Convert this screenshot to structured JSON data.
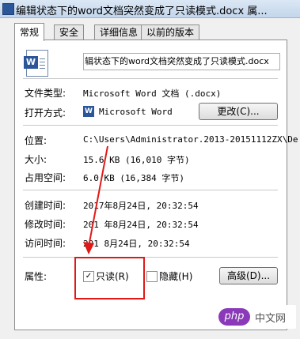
{
  "window": {
    "title": "编辑状态下的word文档突然变成了只读模式.docx 属..."
  },
  "tabs": [
    "常规",
    "安全",
    "详细信息",
    "以前的版本"
  ],
  "file": {
    "name": "辑状态下的word文档突然变成了只读模式.docx"
  },
  "fields": {
    "type_label": "文件类型:",
    "type_value": "Microsoft Word 文档 (.docx)",
    "open_label": "打开方式:",
    "open_value": "Microsoft Word",
    "change_button": "更改(C)...",
    "location_label": "位置:",
    "location_value": "C:\\Users\\Administrator.2013-20151112ZX\\De",
    "size_label": "大小:",
    "size_value": "15.6 KB (16,010 字节)",
    "disk_label": "占用空间:",
    "disk_value": "6.0 KB (16,384 字节)",
    "created_label": "创建时间:",
    "created_value": "2017年8月24日, 20:32:54",
    "modified_label": "修改时间:",
    "modified_value": "201 年8月24日, 20:32:54",
    "accessed_label": "访问时间:",
    "accessed_value": "201  8月24日, 20:32:54",
    "attr_label": "属性:",
    "readonly_label": "只读(R)",
    "hidden_label": "隐藏(H)",
    "advanced_button": "高级(D)..."
  },
  "attributes": {
    "readonly_checked": true,
    "hidden_checked": false
  },
  "watermark": {
    "logo": "php",
    "text": "中文网"
  },
  "colors": {
    "annotation": "#e21818",
    "word_blue": "#2b579a"
  },
  "icons": {
    "checkmark": "✓"
  }
}
